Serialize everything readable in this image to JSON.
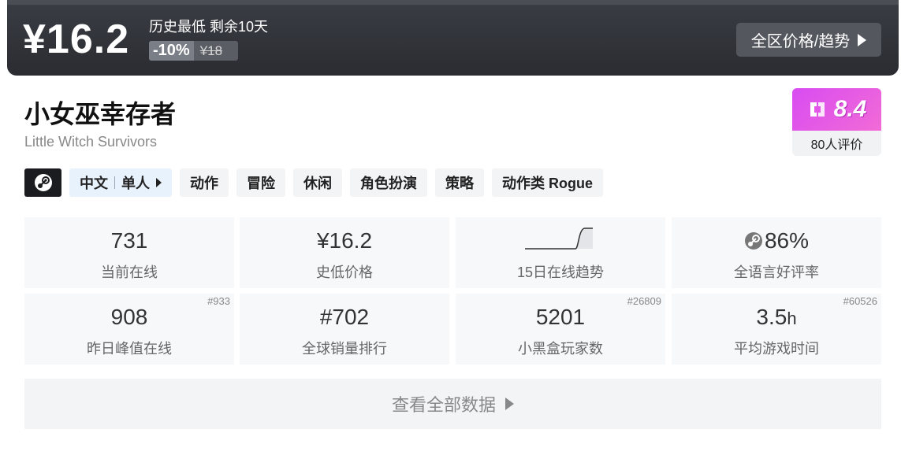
{
  "price_banner": {
    "price": "¥16.2",
    "lowest_text": "历史最低 剩余10天",
    "discount": "-10%",
    "original_price": "¥18",
    "region_button": "全区价格/趋势"
  },
  "game": {
    "title": "小女巫幸存者",
    "subtitle": "Little Witch Survivors"
  },
  "score": {
    "value": "8.4",
    "reviews": "80人评价",
    "accent": "#e05ae8"
  },
  "tags": {
    "lang": "中文",
    "mode": "单人",
    "genres": [
      "动作",
      "冒险",
      "休闲",
      "角色扮演",
      "策略",
      "动作类 Rogue"
    ]
  },
  "stats": {
    "online": {
      "value": "731",
      "label": "当前在线"
    },
    "lowest_price": {
      "value": "¥16.2",
      "label": "史低价格"
    },
    "trend": {
      "label": "15日在线趋势"
    },
    "rating": {
      "value": "86%",
      "label": "全语言好评率"
    },
    "peak": {
      "value": "908",
      "label": "昨日峰值在线",
      "rank": "#933"
    },
    "sales_rank": {
      "value": "#702",
      "label": "全球销量排行"
    },
    "players": {
      "value": "5201",
      "label": "小黑盒玩家数",
      "rank": "#26809"
    },
    "playtime": {
      "value": "3.5",
      "unit": "h",
      "label": "平均游戏时间",
      "rank": "#60526"
    }
  },
  "more_button": "查看全部数据"
}
